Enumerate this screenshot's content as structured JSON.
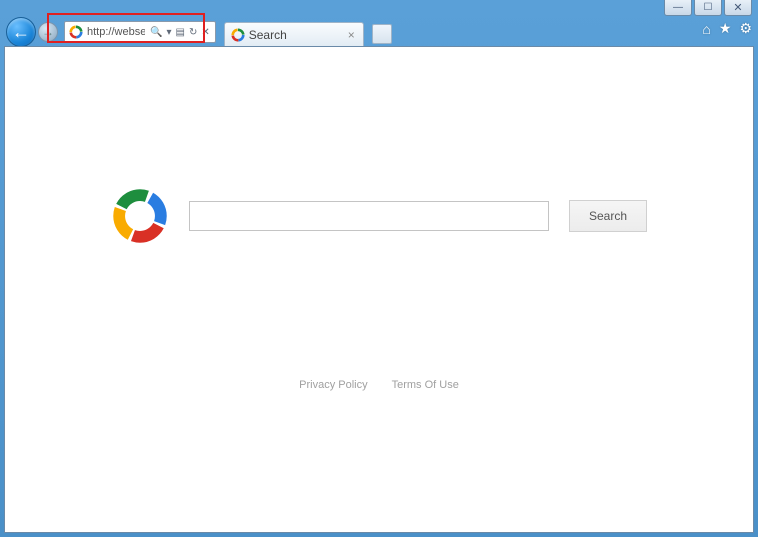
{
  "window_controls": {
    "minimize": "—",
    "maximize": "☐",
    "close": "✕"
  },
  "nav": {
    "back_glyph": "←",
    "forward_glyph": "→"
  },
  "address_bar": {
    "url": "http://websea...",
    "search_glyph": "🔍",
    "dropdown_glyph": "▾",
    "compat_glyph": "▤",
    "refresh_glyph": "↻",
    "stop_glyph": "✕"
  },
  "tab": {
    "label": "Search",
    "close_glyph": "×"
  },
  "right_icons": {
    "home": "⌂",
    "favorites": "★",
    "tools": "⚙"
  },
  "page": {
    "search_button": "Search",
    "search_value": "",
    "privacy": "Privacy Policy",
    "terms": "Terms Of Use"
  },
  "colors": {
    "ring_blue": "#2a7de1",
    "ring_red": "#d93025",
    "ring_yellow": "#f9ab00",
    "ring_green": "#1e8e3e"
  }
}
